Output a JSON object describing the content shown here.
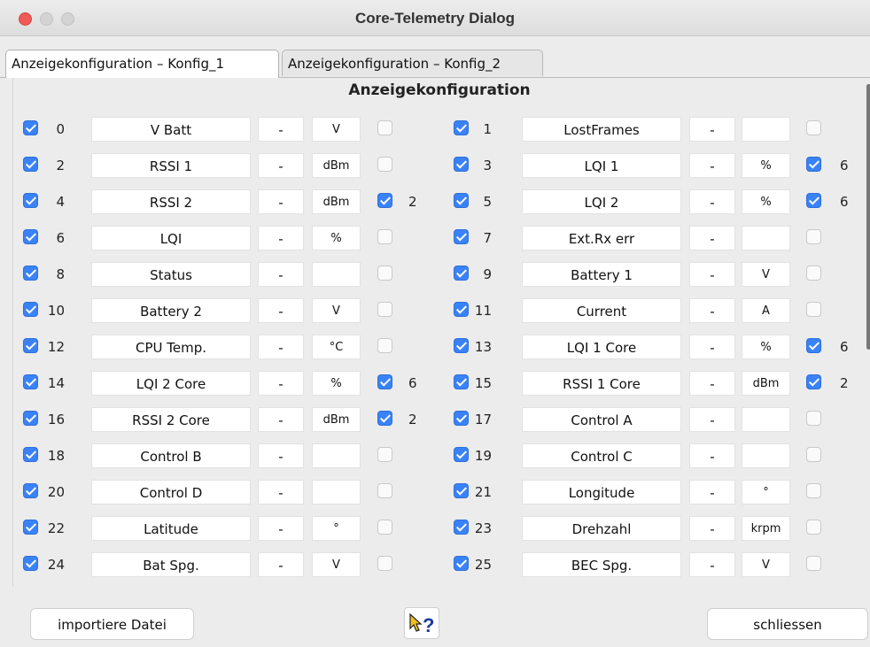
{
  "window": {
    "title": "Core-Telemetry Dialog"
  },
  "tabs": [
    {
      "label": "Anzeigekonfiguration – Konfig_1",
      "active": true
    },
    {
      "label": "Anzeigekonfiguration – Konfig_2",
      "active": false
    }
  ],
  "panel": {
    "title": "Anzeigekonfiguration"
  },
  "rows": [
    {
      "left": {
        "checked": true,
        "index": "0",
        "name": "V Batt",
        "dash": "-",
        "unit": "V",
        "flag": false,
        "flag_value": ""
      },
      "right": {
        "checked": true,
        "index": "1",
        "name": "LostFrames",
        "dash": "-",
        "unit": "",
        "flag": false,
        "flag_value": ""
      }
    },
    {
      "left": {
        "checked": true,
        "index": "2",
        "name": "RSSI 1",
        "dash": "-",
        "unit": "dBm",
        "flag": false,
        "flag_value": ""
      },
      "right": {
        "checked": true,
        "index": "3",
        "name": "LQI 1",
        "dash": "-",
        "unit": "%",
        "flag": true,
        "flag_value": "6"
      }
    },
    {
      "left": {
        "checked": true,
        "index": "4",
        "name": "RSSI 2",
        "dash": "-",
        "unit": "dBm",
        "flag": true,
        "flag_value": "2"
      },
      "right": {
        "checked": true,
        "index": "5",
        "name": "LQI 2",
        "dash": "-",
        "unit": "%",
        "flag": true,
        "flag_value": "6"
      }
    },
    {
      "left": {
        "checked": true,
        "index": "6",
        "name": "LQI",
        "dash": "-",
        "unit": "%",
        "flag": false,
        "flag_value": ""
      },
      "right": {
        "checked": true,
        "index": "7",
        "name": "Ext.Rx err",
        "dash": "-",
        "unit": "",
        "flag": false,
        "flag_value": ""
      }
    },
    {
      "left": {
        "checked": true,
        "index": "8",
        "name": "Status",
        "dash": "-",
        "unit": "",
        "flag": false,
        "flag_value": ""
      },
      "right": {
        "checked": true,
        "index": "9",
        "name": "Battery 1",
        "dash": "-",
        "unit": "V",
        "flag": false,
        "flag_value": ""
      }
    },
    {
      "left": {
        "checked": true,
        "index": "10",
        "name": "Battery 2",
        "dash": "-",
        "unit": "V",
        "flag": false,
        "flag_value": ""
      },
      "right": {
        "checked": true,
        "index": "11",
        "name": "Current",
        "dash": "-",
        "unit": "A",
        "flag": false,
        "flag_value": ""
      }
    },
    {
      "left": {
        "checked": true,
        "index": "12",
        "name": "CPU Temp.",
        "dash": "-",
        "unit": "°C",
        "flag": false,
        "flag_value": ""
      },
      "right": {
        "checked": true,
        "index": "13",
        "name": "LQI 1 Core",
        "dash": "-",
        "unit": "%",
        "flag": true,
        "flag_value": "6"
      }
    },
    {
      "left": {
        "checked": true,
        "index": "14",
        "name": "LQI 2 Core",
        "dash": "-",
        "unit": "%",
        "flag": true,
        "flag_value": "6"
      },
      "right": {
        "checked": true,
        "index": "15",
        "name": "RSSI 1 Core",
        "dash": "-",
        "unit": "dBm",
        "flag": true,
        "flag_value": "2"
      }
    },
    {
      "left": {
        "checked": true,
        "index": "16",
        "name": "RSSI 2 Core",
        "dash": "-",
        "unit": "dBm",
        "flag": true,
        "flag_value": "2"
      },
      "right": {
        "checked": true,
        "index": "17",
        "name": "Control A",
        "dash": "-",
        "unit": "",
        "flag": false,
        "flag_value": ""
      }
    },
    {
      "left": {
        "checked": true,
        "index": "18",
        "name": "Control B",
        "dash": "-",
        "unit": "",
        "flag": false,
        "flag_value": ""
      },
      "right": {
        "checked": true,
        "index": "19",
        "name": "Control C",
        "dash": "-",
        "unit": "",
        "flag": false,
        "flag_value": ""
      }
    },
    {
      "left": {
        "checked": true,
        "index": "20",
        "name": "Control D",
        "dash": "-",
        "unit": "",
        "flag": false,
        "flag_value": ""
      },
      "right": {
        "checked": true,
        "index": "21",
        "name": "Longitude",
        "dash": "-",
        "unit": "°",
        "flag": false,
        "flag_value": ""
      }
    },
    {
      "left": {
        "checked": true,
        "index": "22",
        "name": "Latitude",
        "dash": "-",
        "unit": "°",
        "flag": false,
        "flag_value": ""
      },
      "right": {
        "checked": true,
        "index": "23",
        "name": "Drehzahl",
        "dash": "-",
        "unit": "krpm",
        "flag": false,
        "flag_value": ""
      }
    },
    {
      "left": {
        "checked": true,
        "index": "24",
        "name": "Bat Spg.",
        "dash": "-",
        "unit": "V",
        "flag": false,
        "flag_value": ""
      },
      "right": {
        "checked": true,
        "index": "25",
        "name": "BEC Spg.",
        "dash": "-",
        "unit": "V",
        "flag": false,
        "flag_value": ""
      }
    }
  ],
  "footer": {
    "import_label": "importiere Datei",
    "help_icon": "help-cursor-icon",
    "close_label": "schliessen"
  },
  "colors": {
    "accent": "#3a82f7",
    "close_dot": "#ee5b56"
  }
}
